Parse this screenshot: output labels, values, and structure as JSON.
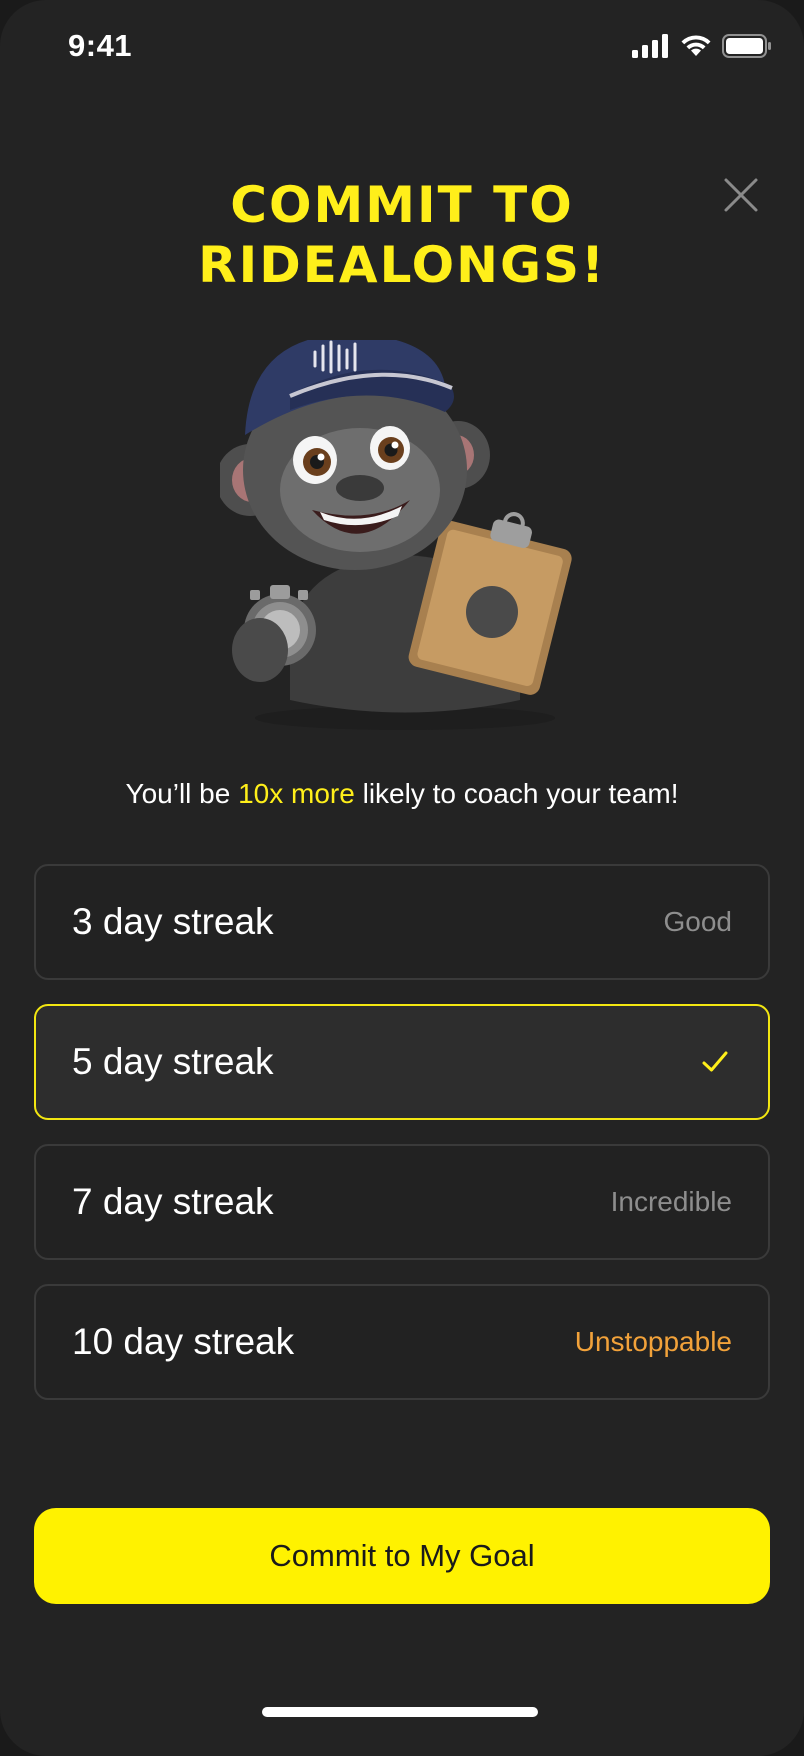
{
  "status_bar": {
    "time": "9:41",
    "icons": [
      "cellular-signal-icon",
      "wifi-icon",
      "battery-icon"
    ]
  },
  "header": {
    "title_line1": "COMMIT TO",
    "title_line2": "RIDEALONGS!",
    "close_icon": "close-icon",
    "accent_color": "#ffef1a"
  },
  "mascot": {
    "icon": "gorilla-coach-mascot"
  },
  "subtitle": {
    "prefix": "You’ll be ",
    "highlight": "10x more",
    "suffix": " likely to coach your team!"
  },
  "options": [
    {
      "label": "3 day streak",
      "tag": "Good",
      "selected": false
    },
    {
      "label": "5 day streak",
      "tag": "",
      "selected": true,
      "icon": "checkmark-icon"
    },
    {
      "label": "7 day streak",
      "tag": "Incredible",
      "selected": false
    },
    {
      "label": "10 day streak",
      "tag": "Unstoppable",
      "selected": false,
      "tag_color": "#f2a23a"
    }
  ],
  "cta": {
    "label": "Commit to My Goal",
    "color": "#fff200"
  }
}
